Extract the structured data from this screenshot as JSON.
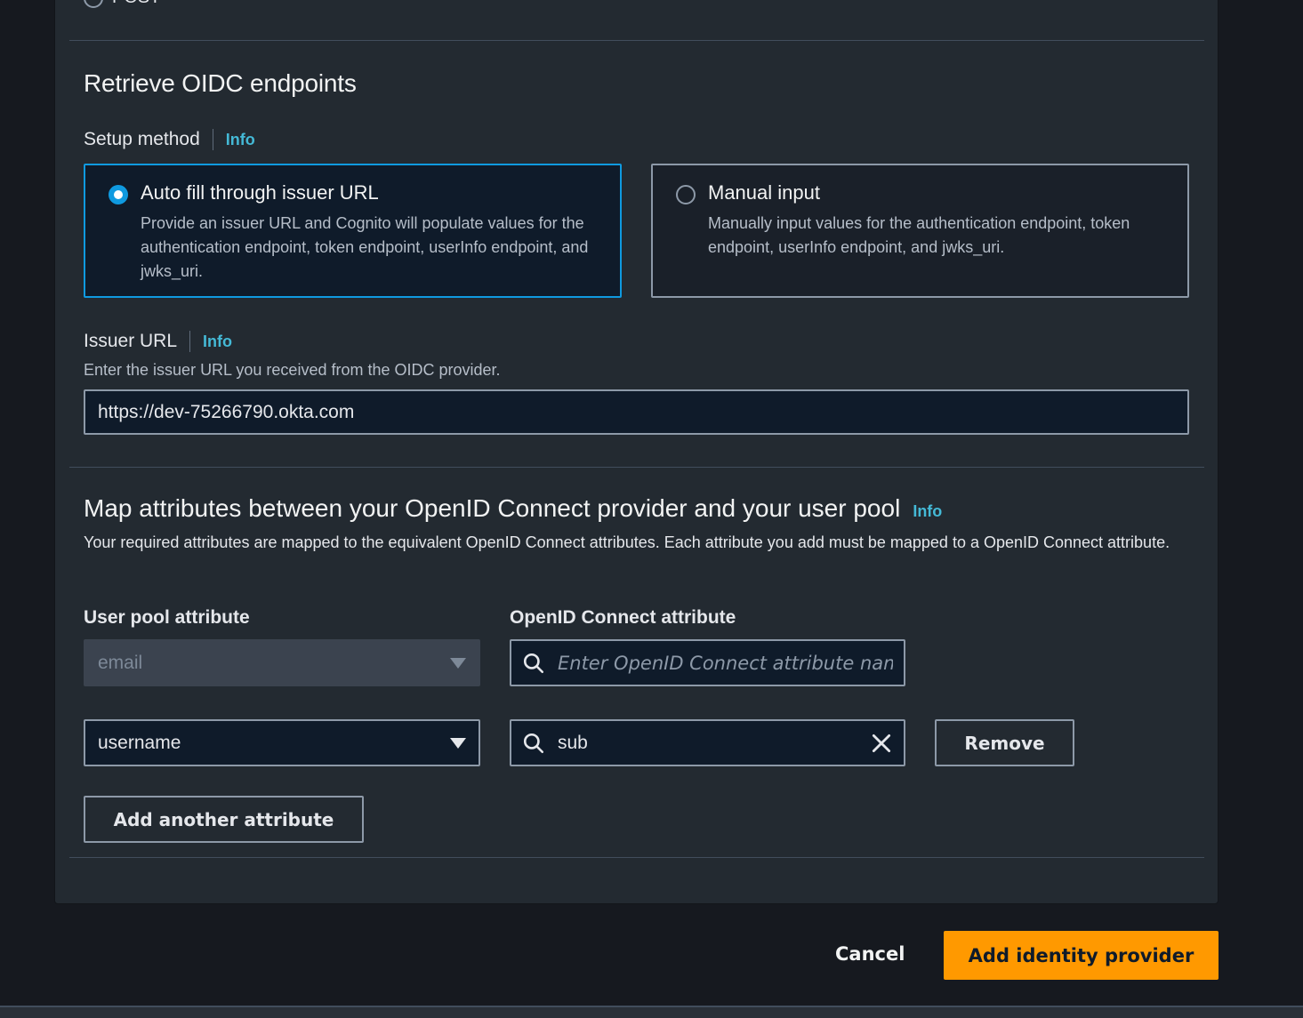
{
  "previous": {
    "radio_label": "POST"
  },
  "oidc": {
    "title": "Retrieve OIDC endpoints",
    "setup_method_label": "Setup method",
    "info": "Info",
    "options": [
      {
        "title": "Auto fill through issuer URL",
        "desc": "Provide an issuer URL and Cognito will populate values for the authentication endpoint, token endpoint, userInfo endpoint, and jwks_uri.",
        "selected": true
      },
      {
        "title": "Manual input",
        "desc": "Manually input values for the authentication endpoint, token endpoint, userInfo endpoint, and jwks_uri.",
        "selected": false
      }
    ],
    "issuer_label": "Issuer URL",
    "issuer_desc": "Enter the issuer URL you received from the OIDC provider.",
    "issuer_value": "https://dev-75266790.okta.com"
  },
  "mapping": {
    "title": "Map attributes between your OpenID Connect provider and your user pool",
    "info": "Info",
    "desc": "Your required attributes are mapped to the equivalent OpenID Connect attributes. Each attribute you add must be mapped to a OpenID Connect attribute.",
    "col_user_pool": "User pool attribute",
    "col_oidc": "OpenID Connect attribute",
    "rows": [
      {
        "user_pool": "email",
        "oidc_value": "",
        "oidc_placeholder": "Enter OpenID Connect attribute name",
        "disabled": true
      },
      {
        "user_pool": "username",
        "oidc_value": "sub",
        "oidc_placeholder": "Enter OpenID Connect attribute name",
        "disabled": false
      }
    ],
    "remove_label": "Remove",
    "add_label": "Add another attribute"
  },
  "footer": {
    "cancel_label": "Cancel",
    "submit_label": "Add identity provider"
  },
  "colors": {
    "accent": "#0f9ae0",
    "primary_button": "#ff9900",
    "link": "#44b9d6"
  }
}
